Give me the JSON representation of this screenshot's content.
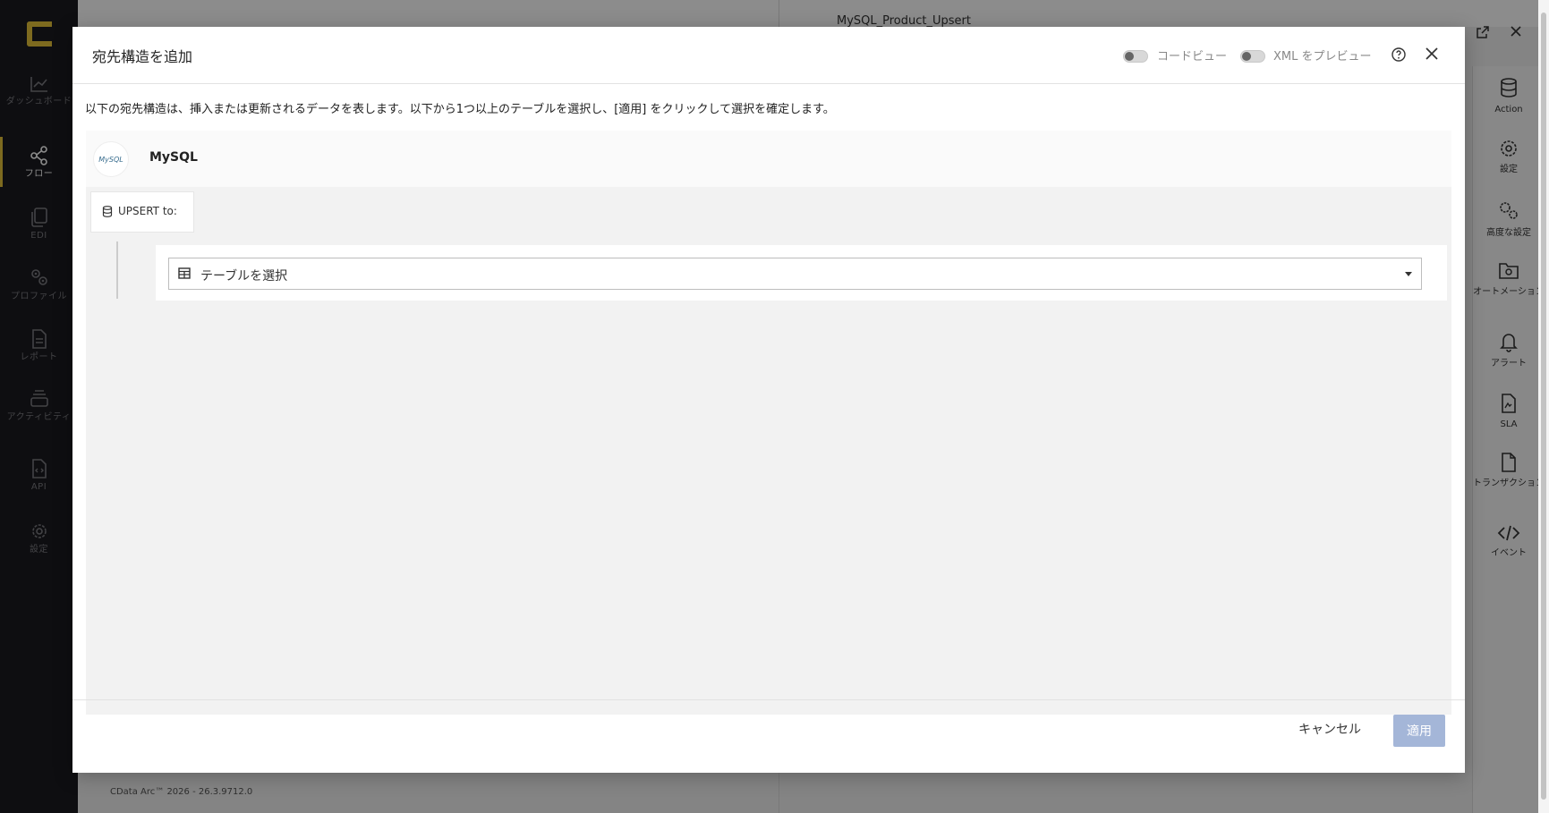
{
  "app": {
    "sidebar": [
      {
        "label": "ダッシュボード",
        "icon": "chart-line-icon"
      },
      {
        "label": "フロー",
        "icon": "share-nodes-icon",
        "active": true
      },
      {
        "label": "EDI",
        "icon": "documents-icon"
      },
      {
        "label": "プロファイル",
        "icon": "gears-icon"
      },
      {
        "label": "レポート",
        "icon": "report-icon"
      },
      {
        "label": "アクティビティ",
        "icon": "layers-icon"
      },
      {
        "label": "API",
        "icon": "api-file-icon"
      },
      {
        "label": "設定",
        "icon": "gear-icon"
      }
    ],
    "background_title": "MySQL_Product_Upsert",
    "footer_version": "CData Arc™ 2026 - 26.3.9712.0",
    "right_toolbar": [
      {
        "label": "Action",
        "icon": "database-icon"
      },
      {
        "label": "設定",
        "icon": "gear-icon"
      },
      {
        "label": "高度な設定",
        "icon": "gears-icon"
      },
      {
        "label": "オートメーション",
        "icon": "folder-gear-icon"
      },
      {
        "label": "アラート",
        "icon": "bell-icon"
      },
      {
        "label": "SLA",
        "icon": "sla-file-icon"
      },
      {
        "label": "トランザクション",
        "icon": "file-icon"
      },
      {
        "label": "イベント",
        "icon": "code-icon"
      }
    ]
  },
  "modal": {
    "title": "宛先構造を追加",
    "code_view_label": "コードビュー",
    "xml_preview_label": "XML をプレビュー",
    "intro": "以下の宛先構造は、挿入または更新されるデータを表します。以下から1つ以上のテーブルを選択し、[適用] をクリックして選択を確定します。",
    "source_name": "MySQL",
    "source_logo_text": "MySQL",
    "upsert_label": "UPSERT to:",
    "table_select_placeholder": "テーブルを選択",
    "cancel_label": "キャンセル",
    "apply_label": "適用"
  },
  "colors": {
    "accent": "#e3c23a",
    "apply_disabled": "#a4b6d8",
    "sidebar_bg": "#1b1b1f"
  }
}
